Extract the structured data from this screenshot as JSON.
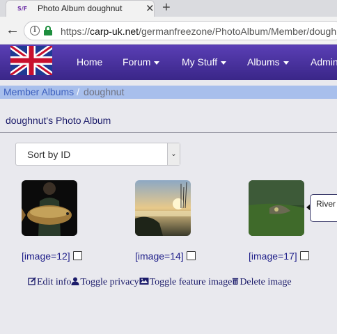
{
  "browser": {
    "tab_title": "Photo Album doughnut",
    "favicon_text": "S/F",
    "close_glyph": "✕",
    "newtab_glyph": "+",
    "back_glyph": "←",
    "url_prefix": "https://",
    "url_domain": "carp-uk.net",
    "url_path": "/germanfreezone/PhotoAlbum/Member/dough"
  },
  "navbar": {
    "logo_icon": "union-jack-flag-icon",
    "items": [
      {
        "label": "Home"
      },
      {
        "label": "Forum"
      },
      {
        "label": "My Stuff"
      },
      {
        "label": "Albums"
      },
      {
        "label": "Admin"
      }
    ]
  },
  "breadcrumb": {
    "link": "Member Albums",
    "separator": "/",
    "current": "doughnut"
  },
  "album": {
    "title": "doughnut's Photo Album",
    "sort_selected": "Sort by ID"
  },
  "images": [
    {
      "code": "[image=12]",
      "icon": "carp-photo-icon"
    },
    {
      "code": "[image=14]",
      "icon": "sunrise-photo-icon"
    },
    {
      "code": "[image=17]",
      "icon": "river-photo-icon"
    }
  ],
  "tooltip": {
    "text": "River"
  },
  "actions": {
    "edit": "Edit info",
    "privacy": "Toggle privacy",
    "feature": "Toggle feature image",
    "delete": "Delete image"
  }
}
